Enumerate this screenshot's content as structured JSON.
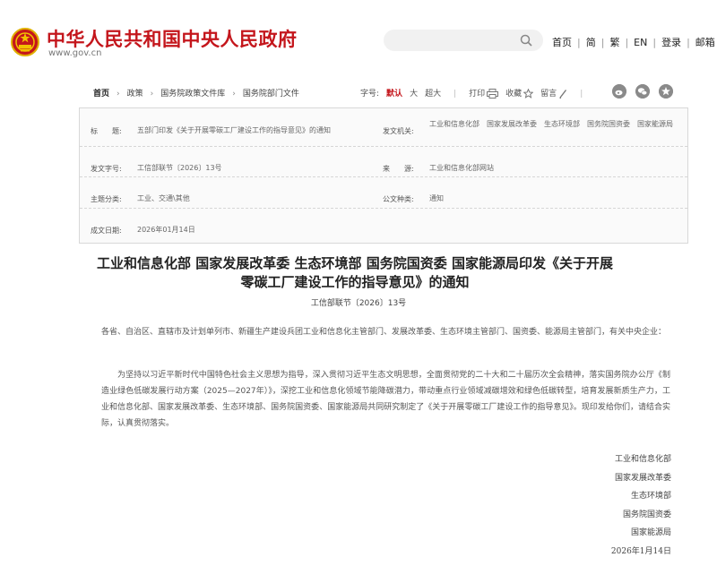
{
  "header": {
    "site_title": "中华人民共和国中央人民政府",
    "site_url": "www.gov.cn",
    "nav": [
      "首页",
      "简",
      "繁",
      "EN",
      "登录",
      "邮箱"
    ]
  },
  "breadcrumb": [
    "首页",
    "政策",
    "国务院政策文件库",
    "国务院部门文件"
  ],
  "tools": {
    "font_size_label": "字号:",
    "font_default": "默认",
    "font_large": "大",
    "font_xlarge": "超大",
    "print": "打印",
    "favorite": "收藏",
    "comment": "留言"
  },
  "meta": {
    "title_label": "标　　题:",
    "title_value": "五部门印发《关于开展零碳工厂建设工作的指导意见》的通知",
    "issuer_label": "发文机关:",
    "issuer_value": "工业和信息化部　国家发展改革委　生态环境部　国务院国资委　国家能源局",
    "docno_label": "发文字号:",
    "docno_value": "工信部联节〔2026〕13号",
    "source_label": "来　　源:",
    "source_value": "工业和信息化部网站",
    "topic_label": "主题分类:",
    "topic_value": "工业、交通\\其他",
    "type_label": "公文种类:",
    "type_value": "通知",
    "date_label": "成文日期:",
    "date_value": "2026年01月14日"
  },
  "article": {
    "title": "工业和信息化部 国家发展改革委 生态环境部 国务院国资委 国家能源局印发《关于开展零碳工厂建设工作的指导意见》的通知",
    "doc_no": "工信部联节〔2026〕13号",
    "recipients": "各省、自治区、直辖市及计划单列市、新疆生产建设兵团工业和信息化主管部门、发展改革委、生态环境主管部门、国资委、能源局主管部门，有关中央企业：",
    "body": "为坚持以习近平新时代中国特色社会主义思想为指导，深入贯彻习近平生态文明思想，全面贯彻党的二十大和二十届历次全会精神，落实国务院办公厅《制造业绿色低碳发展行动方案（2025—2027年）》，深挖工业和信息化领域节能降碳潜力，带动重点行业领域减碳增效和绿色低碳转型，培育发展新质生产力，工业和信息化部、国家发展改革委、生态环境部、国务院国资委、国家能源局共同研究制定了《关于开展零碳工厂建设工作的指导意见》。现印发给你们，请结合实际，认真贯彻落实。",
    "signers": [
      "工业和信息化部",
      "国家发展改革委",
      "生态环境部",
      "国务院国资委",
      "国家能源局",
      "2026年1月14日"
    ]
  },
  "colors": {
    "brand_red": "#c4161c",
    "meta_bg": "#fafafa",
    "search_bg": "#f1f1f1"
  },
  "icons": [
    "national-emblem-icon",
    "search-icon",
    "print-icon",
    "favorite-icon",
    "comment-icon",
    "weibo-icon",
    "wechat-icon",
    "star-icon"
  ]
}
